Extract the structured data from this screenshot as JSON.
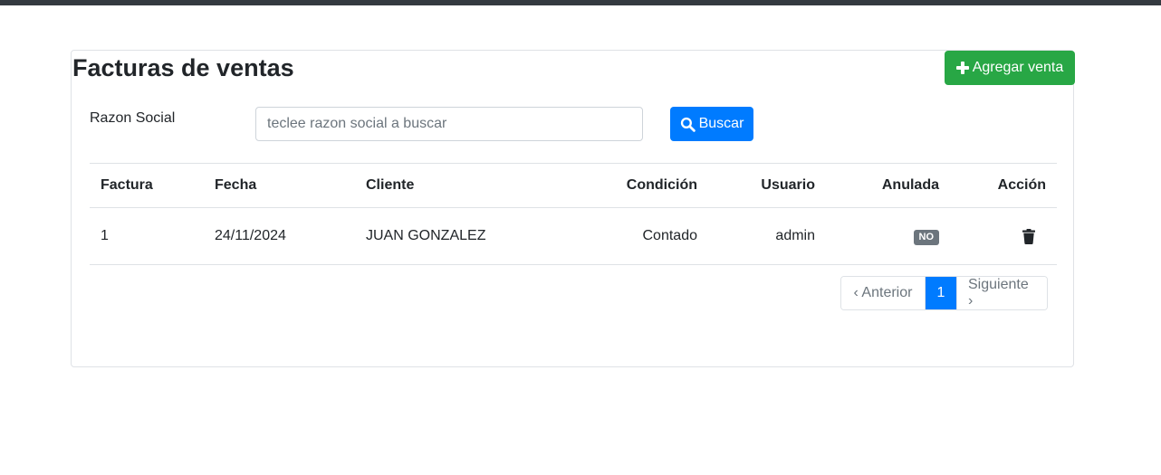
{
  "page": {
    "title": "Facturas de ventas"
  },
  "actions": {
    "add_label": "Agregar venta"
  },
  "search": {
    "label": "Razon Social",
    "placeholder": "teclee razon social a buscar",
    "button_label": "Buscar"
  },
  "table": {
    "headers": [
      "Factura",
      "Fecha",
      "Cliente",
      "Condición",
      "Usuario",
      "Anulada",
      "Acción"
    ],
    "rows": [
      {
        "factura": "1",
        "fecha": "24/11/2024",
        "cliente": "JUAN GONZALEZ",
        "condicion": "Contado",
        "usuario": "admin",
        "anulada": "NO",
        "accion_icon": "trash-icon"
      }
    ]
  },
  "pagination": {
    "prev": "‹ Anterior",
    "current": "1",
    "next": "Siguiente ›"
  },
  "colors": {
    "topbar": "#343a40",
    "success": "#28a745",
    "primary": "#007bff",
    "badge": "#6c757d"
  }
}
